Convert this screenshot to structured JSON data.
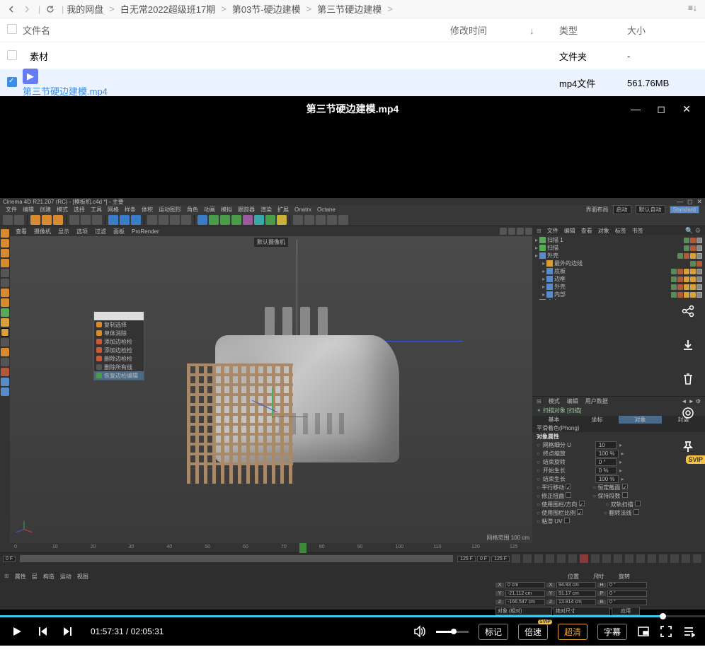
{
  "nav": {
    "breadcrumbs": [
      "我的网盘",
      "白无常2022超级班17期",
      "第03节-硬边建模",
      "第三节硬边建模"
    ]
  },
  "fileHeader": {
    "name": "文件名",
    "date": "修改时间",
    "type": "类型",
    "size": "大小"
  },
  "files": [
    {
      "checked": false,
      "icon": "folder",
      "name": "素材",
      "date": "",
      "type": "文件夹",
      "size": "-",
      "link": false
    },
    {
      "checked": true,
      "icon": "video",
      "name": "第三节硬边建模.mp4",
      "date": "",
      "type": "mp4文件",
      "size": "561.76MB",
      "link": true
    }
  ],
  "video": {
    "title": "第三节硬边建模.mp4"
  },
  "c4d": {
    "titlebar": "Cinema 4D R21.207 (RC) - [模板机.c4d *] - 主要",
    "menu": [
      "文件",
      "编辑",
      "创建",
      "模式",
      "选择",
      "工具",
      "网格",
      "样条",
      "体积",
      "运动图形",
      "角色",
      "动画",
      "模拟",
      "跟踪器",
      "渲染",
      "扩展",
      "Onatrx",
      "Octane"
    ],
    "layoutLabel": "界面布局",
    "layoutVal1": "启动",
    "layoutVal2": "默认自动",
    "layoutStd": "Standard",
    "viewTabs": [
      "查看",
      "摄像机",
      "显示",
      "选项",
      "过滤",
      "面板",
      "ProRender"
    ],
    "camLabel": "默认摄像机",
    "vpInfo": "网格范围  100 cm",
    "contextMenu": [
      "复制选择",
      "单体消除",
      "添加边检检",
      "添加边检检",
      "删除边检检",
      "删除所有线",
      "恢复边检编辑"
    ],
    "rightTabs": [
      "文件",
      "编辑",
      "查看",
      "对象",
      "标签",
      "书签"
    ],
    "objects": [
      {
        "name": "扫描 1",
        "indent": 0,
        "ic": "#5aa85a",
        "tags": [
          "g",
          "r",
          "c"
        ]
      },
      {
        "name": "扫描",
        "indent": 0,
        "ic": "#5aa85a",
        "tags": [
          "g",
          "r",
          "c"
        ]
      },
      {
        "name": "外壳",
        "indent": 0,
        "ic": "#5a8ac8",
        "tags": [
          "g",
          "r",
          "o",
          "c"
        ]
      },
      {
        "name": "最外的边线",
        "indent": 1,
        "ic": "#d8a03a",
        "tags": [
          "g",
          "r"
        ]
      },
      {
        "name": "底板",
        "indent": 1,
        "ic": "#5a8ac8",
        "tags": [
          "g",
          "r",
          "o",
          "o",
          "c"
        ]
      },
      {
        "name": "边框",
        "indent": 1,
        "ic": "#5a8ac8",
        "tags": [
          "g",
          "r",
          "o",
          "o",
          "c"
        ]
      },
      {
        "name": "外壳",
        "indent": 1,
        "ic": "#5a8ac8",
        "tags": [
          "g",
          "r",
          "o",
          "o",
          "c"
        ]
      },
      {
        "name": "内部",
        "indent": 1,
        "ic": "#5a8ac8",
        "tags": [
          "g",
          "r",
          "o",
          "o",
          "c"
        ]
      },
      {
        "name": "空白",
        "indent": 0,
        "ic": "#888",
        "tags": [
          "g",
          "r"
        ]
      }
    ],
    "attrTabs": [
      "模式",
      "编辑",
      "用户数据"
    ],
    "attrTitle": "扫描对象 [扫描]",
    "attrSubTabs": [
      "基本",
      "坐标",
      "对象",
      "封盖"
    ],
    "attrPhong": "平滑着色(Phong)",
    "attrSec": "对象属性",
    "attr": [
      {
        "l": "网格细分 U",
        "v": "10"
      },
      {
        "l": "终点缩放",
        "v": "100 %"
      },
      {
        "l": "结束旋转",
        "v": "0 °"
      },
      {
        "l": "开始生长",
        "v": "0 %"
      },
      {
        "l": "结束生长",
        "v": "100 %"
      }
    ],
    "attrChecks1": [
      {
        "l": "平行移动",
        "c": true
      },
      {
        "l": "恒定截面",
        "c": true
      }
    ],
    "attrChecks2": [
      {
        "l": "修正扭曲",
        "c": false
      },
      {
        "l": "保持段数",
        "c": false
      }
    ],
    "attrChecks3": [
      {
        "l": "使用围栏/方向",
        "c": true
      },
      {
        "l": "双轨扫描",
        "c": false
      }
    ],
    "attrChecks4": [
      {
        "l": "使用围栏比例",
        "c": true
      },
      {
        "l": "翻转法线",
        "c": false
      }
    ],
    "attrChecks5": [
      {
        "l": "粘滞 UV",
        "c": false
      }
    ],
    "timeline": {
      "start": "0 F",
      "end": "125 F",
      "from": "0 F",
      "to": "125 F",
      "ticks": [
        "0",
        "10",
        "20",
        "30",
        "40",
        "50",
        "60",
        "70",
        "80",
        "90",
        "100",
        "110",
        "120",
        "125"
      ],
      "play": 72
    },
    "bottomLeftTabs": [
      "属性",
      "层",
      "构造",
      "运动",
      "视图"
    ],
    "bottomRightTabs": [
      "位置",
      "尺寸",
      "旋转"
    ],
    "coords": [
      {
        "ax": "X",
        "p": "0 cm",
        "s": "94.93 cm",
        "r": "0 °"
      },
      {
        "ax": "Y",
        "p": "-21.112 cm",
        "s": "91.17 cm",
        "r": "0 °"
      },
      {
        "ax": "Z",
        "p": "-166.547 cm",
        "s": "13.814 cm",
        "r": "0 °"
      }
    ],
    "coordsFooter": {
      "l": "对象 (相对)",
      "r": "绝对尺寸",
      "btn": "应用"
    }
  },
  "floatTools": {
    "svip": "SVIP"
  },
  "player": {
    "current": "01:57:31",
    "total": "02:05:31",
    "mark": "标记",
    "speed": "倍速",
    "quality": "超清",
    "subs": "字幕",
    "svip": "SVIP"
  }
}
